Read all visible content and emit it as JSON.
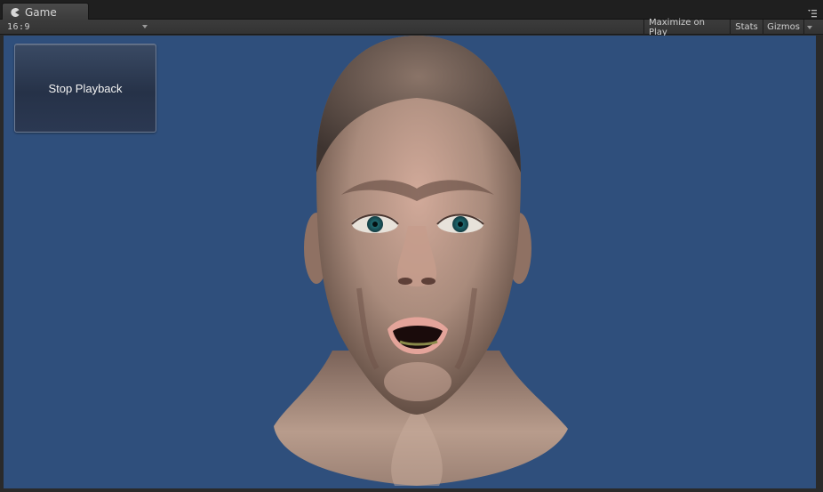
{
  "tab": {
    "label": "Game",
    "icon": "pacman-icon"
  },
  "toolbar": {
    "aspect_value": "16:9",
    "maximize_label": "Maximize on Play",
    "stats_label": "Stats",
    "gizmos_label": "Gizmos"
  },
  "viewport": {
    "background_color": "#2f4f7c",
    "stop_button_label": "Stop Playback",
    "subject": "3d-head-model"
  }
}
